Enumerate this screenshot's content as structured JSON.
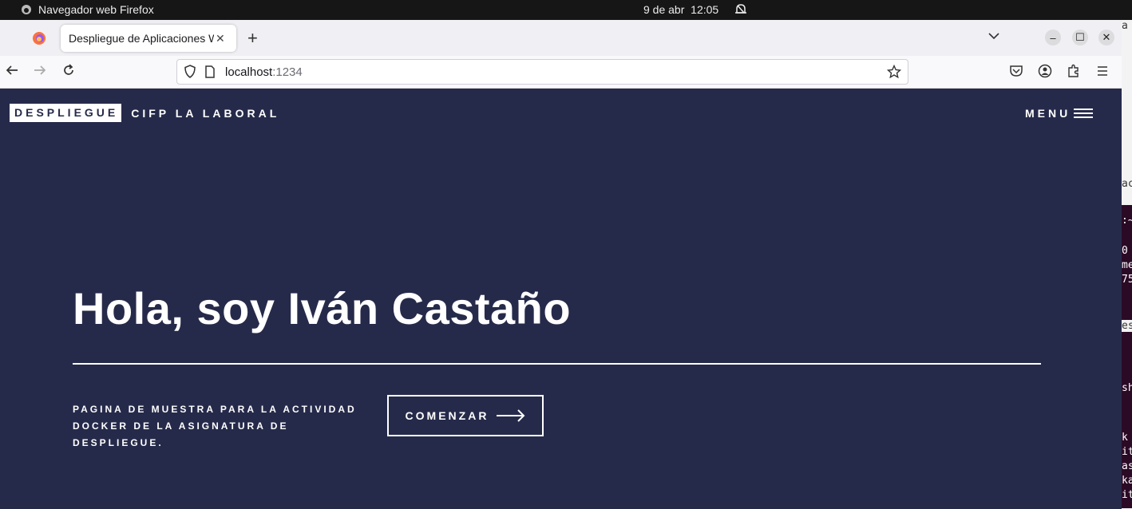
{
  "system": {
    "app_name": "Navegador web Firefox",
    "date": "9 de abr",
    "time": "12:05"
  },
  "browser": {
    "tab_title": "Despliegue de Aplicaciones W",
    "url_host": "localhost",
    "url_port": ":1234"
  },
  "site": {
    "brand": "DESPLIEGUE",
    "brand_sub": "CIFP LA LABORAL",
    "menu_label": "MENU",
    "hero_title": "Hola, soy Iván Castaño",
    "description_line1": "PAGINA DE MUESTRA PARA LA ACTIVIDAD",
    "description_line2": "DOCKER DE LA ASIGNATURA DE DESPLIEGUE.",
    "cta_label": "COMENZAR",
    "background_color": "#262a4a"
  },
  "background_window": {
    "fragments": [
      "a",
      "ac",
      ":~",
      "0",
      "me",
      "75",
      "es",
      "sh",
      "k",
      "it",
      "as",
      "ka",
      "it"
    ]
  }
}
